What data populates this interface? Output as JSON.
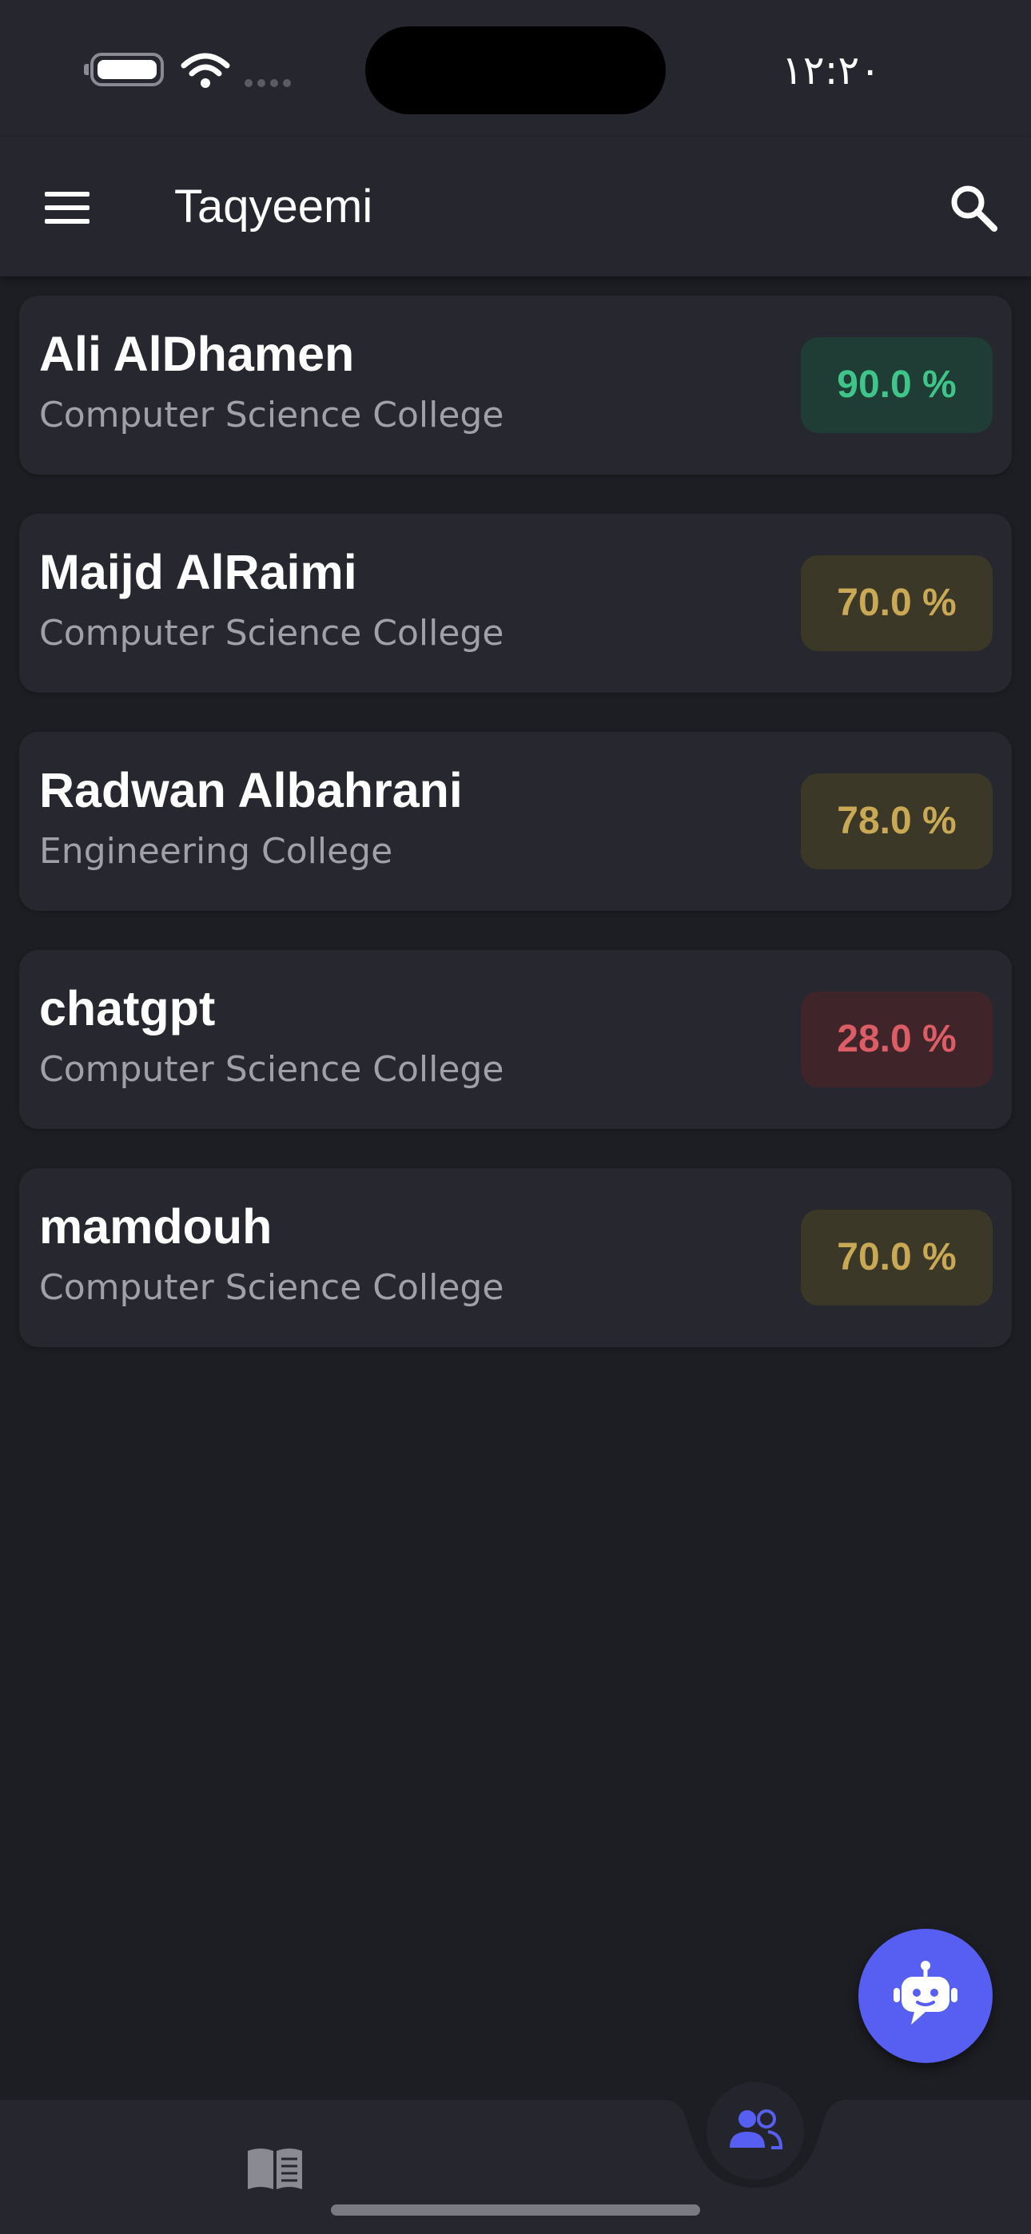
{
  "status_bar": {
    "time": "١٢:٢٠",
    "icons": [
      "battery-icon",
      "wifi-icon",
      "signal-icon"
    ]
  },
  "app_bar": {
    "title": "Taqyeemi",
    "menu_icon": "menu-icon",
    "search_icon": "search-icon"
  },
  "list": {
    "items": [
      {
        "name": "Ali AlDhamen",
        "college": "Computer Science College",
        "score": "90.0 %",
        "status": "green"
      },
      {
        "name": "Maijd AlRaimi",
        "college": "Computer Science College",
        "score": "70.0 %",
        "status": "yellow"
      },
      {
        "name": "Radwan Albahrani",
        "college": "Engineering College",
        "score": "78.0 %",
        "status": "yellow"
      },
      {
        "name": "chatgpt",
        "college": "Computer Science College",
        "score": "28.0 %",
        "status": "red"
      },
      {
        "name": "mamdouh",
        "college": "Computer Science College",
        "score": "70.0 %",
        "status": "yellow"
      }
    ]
  },
  "fab": {
    "icon": "robot-icon"
  },
  "bottom_nav": {
    "items": [
      {
        "icon": "book-icon",
        "active": false
      },
      {
        "icon": "people-icon",
        "active": true
      }
    ]
  },
  "colors": {
    "background": "#1d1e23",
    "surface": "#27282f",
    "accent": "#575ff2",
    "score_green": "#3fc48a",
    "score_yellow": "#c9a956",
    "score_red": "#dc5d66"
  }
}
